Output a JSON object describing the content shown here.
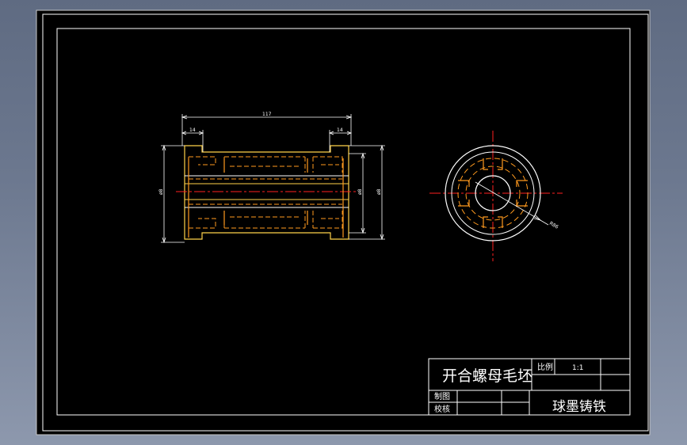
{
  "drawing": {
    "title": "开合螺母毛坯",
    "material": "球墨铸铁",
    "labels": {
      "scale_label": "比例",
      "scale_value": "1:1",
      "drawn_by": "制图",
      "checked_by": "校核"
    },
    "dimensions": {
      "overall_length": "117",
      "left_flange": "14",
      "right_flange": "14",
      "left_diameter": "ø8",
      "right_diameter": "ø8",
      "inner_diameter": "ø8",
      "radius_note": "R86"
    }
  },
  "colors": {
    "background": "#000000",
    "border": "#ffffff",
    "outline": "#ffd24a",
    "hidden": "#ff9a1e",
    "centerline": "#ff2020",
    "dimension": "#ffffff"
  }
}
